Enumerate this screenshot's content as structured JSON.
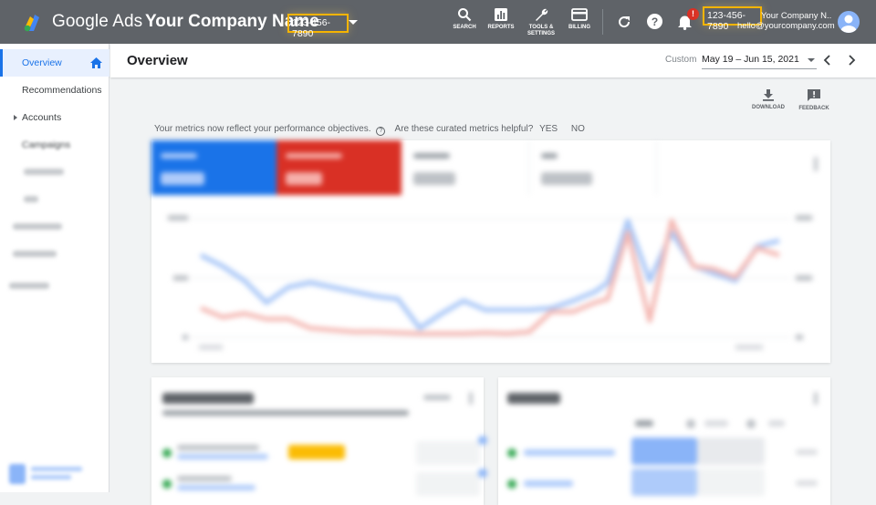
{
  "topbar": {
    "brand": "Google Ads",
    "company_name": "Your Company Name",
    "phone": "123-456-7890",
    "tools": [
      "SEARCH",
      "REPORTS",
      "TOOLS &",
      "SETTINGS",
      "BILLING"
    ],
    "notification_count": "!",
    "account_phone": "123-456-7890",
    "account_name": "Your Company N...",
    "account_email": "hello@yourcompany.com"
  },
  "sidebar": {
    "items": [
      "Overview",
      "Recommendations",
      "Accounts",
      "Campaigns"
    ]
  },
  "header": {
    "title": "Overview",
    "date_label": "Custom",
    "date_range": "May 19 – Jun 15, 2021"
  },
  "actions": {
    "download": "DOWNLOAD",
    "feedback": "FEEDBACK"
  },
  "metrics_note": {
    "text": "Your metrics now reflect your performance objectives.",
    "question": "Are these curated metrics helpful?",
    "yes": "YES",
    "no": "NO"
  },
  "colors": {
    "topbar": "#5f6368",
    "accent_blue": "#1a73e8",
    "accent_red": "#d93025",
    "highlight_yellow": "#f6b400"
  }
}
